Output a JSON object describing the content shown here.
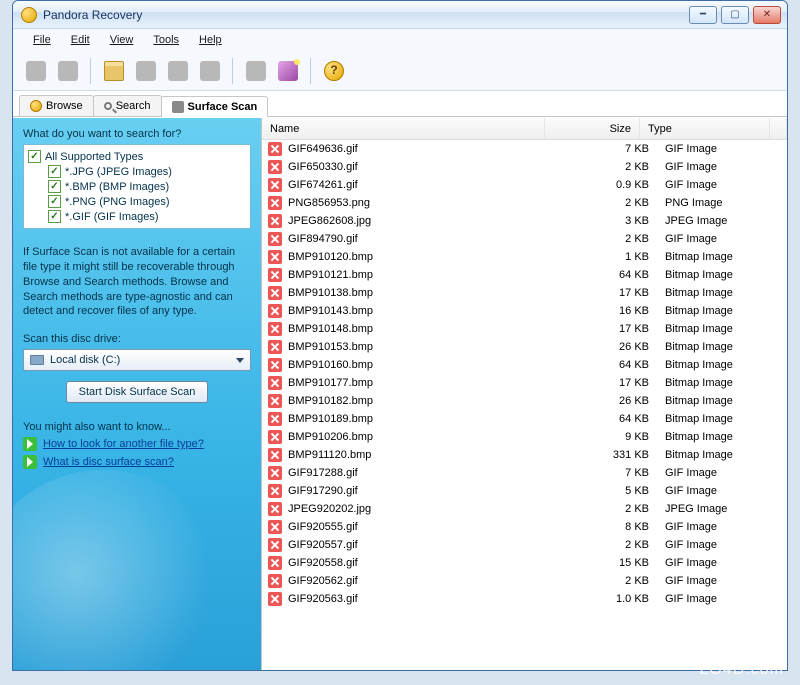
{
  "window": {
    "title": "Pandora Recovery"
  },
  "menu": [
    "File",
    "Edit",
    "View",
    "Tools",
    "Help"
  ],
  "tabs": [
    {
      "label": "Browse",
      "icon": "browse"
    },
    {
      "label": "Search",
      "icon": "search"
    },
    {
      "label": "Surface Scan",
      "icon": "scan",
      "active": true
    }
  ],
  "sidebar": {
    "prompt": "What do you want to search for?",
    "all_label": "All Supported Types",
    "types": [
      "*.JPG (JPEG Images)",
      "*.BMP (BMP Images)",
      "*.PNG (PNG Images)",
      "*.GIF (GIF Images)"
    ],
    "info": "If Surface Scan is not available for a certain file type it might still be recoverable through Browse and Search methods. Browse and Search methods are type-agnostic and can detect and recover files of any type.",
    "scan_label": "Scan this disc drive:",
    "drive_selected": "Local disk (C:)",
    "scan_button": "Start Disk Surface Scan",
    "also_heading": "You might also want to know...",
    "link1": "How to look for another file type?",
    "link2": "What is disc surface scan?"
  },
  "columns": {
    "name": "Name",
    "size": "Size",
    "type": "Type"
  },
  "files": [
    {
      "name": "GIF649636.gif",
      "size": "7 KB",
      "type": "GIF Image"
    },
    {
      "name": "GIF650330.gif",
      "size": "2 KB",
      "type": "GIF Image"
    },
    {
      "name": "GIF674261.gif",
      "size": "0.9 KB",
      "type": "GIF Image"
    },
    {
      "name": "PNG856953.png",
      "size": "2 KB",
      "type": "PNG Image"
    },
    {
      "name": "JPEG862608.jpg",
      "size": "3 KB",
      "type": "JPEG Image"
    },
    {
      "name": "GIF894790.gif",
      "size": "2 KB",
      "type": "GIF Image"
    },
    {
      "name": "BMP910120.bmp",
      "size": "1 KB",
      "type": "Bitmap Image"
    },
    {
      "name": "BMP910121.bmp",
      "size": "64 KB",
      "type": "Bitmap Image"
    },
    {
      "name": "BMP910138.bmp",
      "size": "17 KB",
      "type": "Bitmap Image"
    },
    {
      "name": "BMP910143.bmp",
      "size": "16 KB",
      "type": "Bitmap Image"
    },
    {
      "name": "BMP910148.bmp",
      "size": "17 KB",
      "type": "Bitmap Image"
    },
    {
      "name": "BMP910153.bmp",
      "size": "26 KB",
      "type": "Bitmap Image"
    },
    {
      "name": "BMP910160.bmp",
      "size": "64 KB",
      "type": "Bitmap Image"
    },
    {
      "name": "BMP910177.bmp",
      "size": "17 KB",
      "type": "Bitmap Image"
    },
    {
      "name": "BMP910182.bmp",
      "size": "26 KB",
      "type": "Bitmap Image"
    },
    {
      "name": "BMP910189.bmp",
      "size": "64 KB",
      "type": "Bitmap Image"
    },
    {
      "name": "BMP910206.bmp",
      "size": "9 KB",
      "type": "Bitmap Image"
    },
    {
      "name": "BMP911120.bmp",
      "size": "331 KB",
      "type": "Bitmap Image"
    },
    {
      "name": "GIF917288.gif",
      "size": "7 KB",
      "type": "GIF Image"
    },
    {
      "name": "GIF917290.gif",
      "size": "5 KB",
      "type": "GIF Image"
    },
    {
      "name": "JPEG920202.jpg",
      "size": "2 KB",
      "type": "JPEG Image"
    },
    {
      "name": "GIF920555.gif",
      "size": "8 KB",
      "type": "GIF Image"
    },
    {
      "name": "GIF920557.gif",
      "size": "2 KB",
      "type": "GIF Image"
    },
    {
      "name": "GIF920558.gif",
      "size": "15 KB",
      "type": "GIF Image"
    },
    {
      "name": "GIF920562.gif",
      "size": "2 KB",
      "type": "GIF Image"
    },
    {
      "name": "GIF920563.gif",
      "size": "1.0 KB",
      "type": "GIF Image"
    }
  ],
  "watermark": "LO4D.com"
}
